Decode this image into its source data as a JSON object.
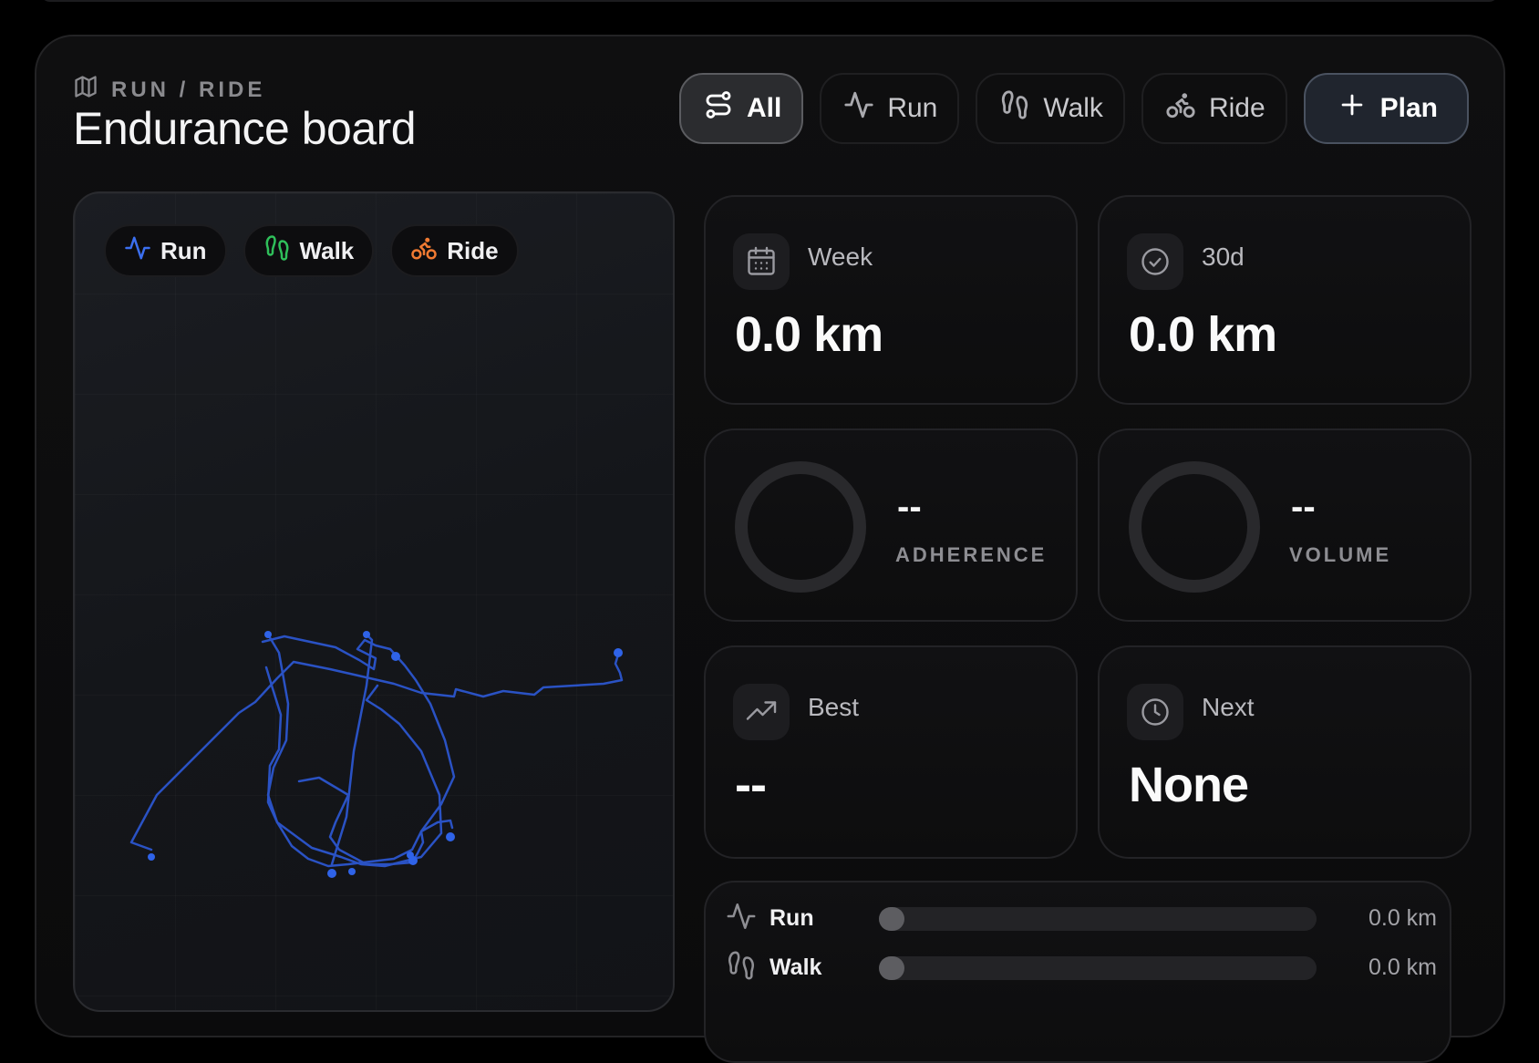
{
  "header": {
    "eyebrow": "RUN / RIDE",
    "title": "Endurance board"
  },
  "filters": [
    {
      "label": "All",
      "icon": "route-icon",
      "active": true
    },
    {
      "label": "Run",
      "icon": "activity-icon",
      "active": false
    },
    {
      "label": "Walk",
      "icon": "footprints-icon",
      "active": false
    },
    {
      "label": "Ride",
      "icon": "bike-icon",
      "active": false
    }
  ],
  "plan_label": "Plan",
  "map": {
    "chips": [
      {
        "label": "Run",
        "icon": "activity-icon",
        "color": "#3b6ff0"
      },
      {
        "label": "Walk",
        "icon": "footprints-icon",
        "color": "#2fbf5a"
      },
      {
        "label": "Ride",
        "icon": "bike-icon",
        "color": "#f07a32"
      }
    ],
    "route_color": "#2f63e8"
  },
  "stats": {
    "week": {
      "label": "Week",
      "value": "0.0 km",
      "icon": "calendar-icon"
    },
    "thirty": {
      "label": "30d",
      "value": "0.0 km",
      "icon": "check-circle-icon"
    },
    "adherence": {
      "value": "--",
      "label": "ADHERENCE"
    },
    "volume": {
      "value": "--",
      "label": "VOLUME"
    },
    "best": {
      "label": "Best",
      "value": "--",
      "icon": "trending-up-icon"
    },
    "next": {
      "label": "Next",
      "value": "None",
      "icon": "clock-icon"
    }
  },
  "breakdown": [
    {
      "label": "Run",
      "value": "0.0 km",
      "icon": "activity-icon",
      "progress": 0
    },
    {
      "label": "Walk",
      "value": "0.0 km",
      "icon": "footprints-icon",
      "progress": 0
    }
  ]
}
